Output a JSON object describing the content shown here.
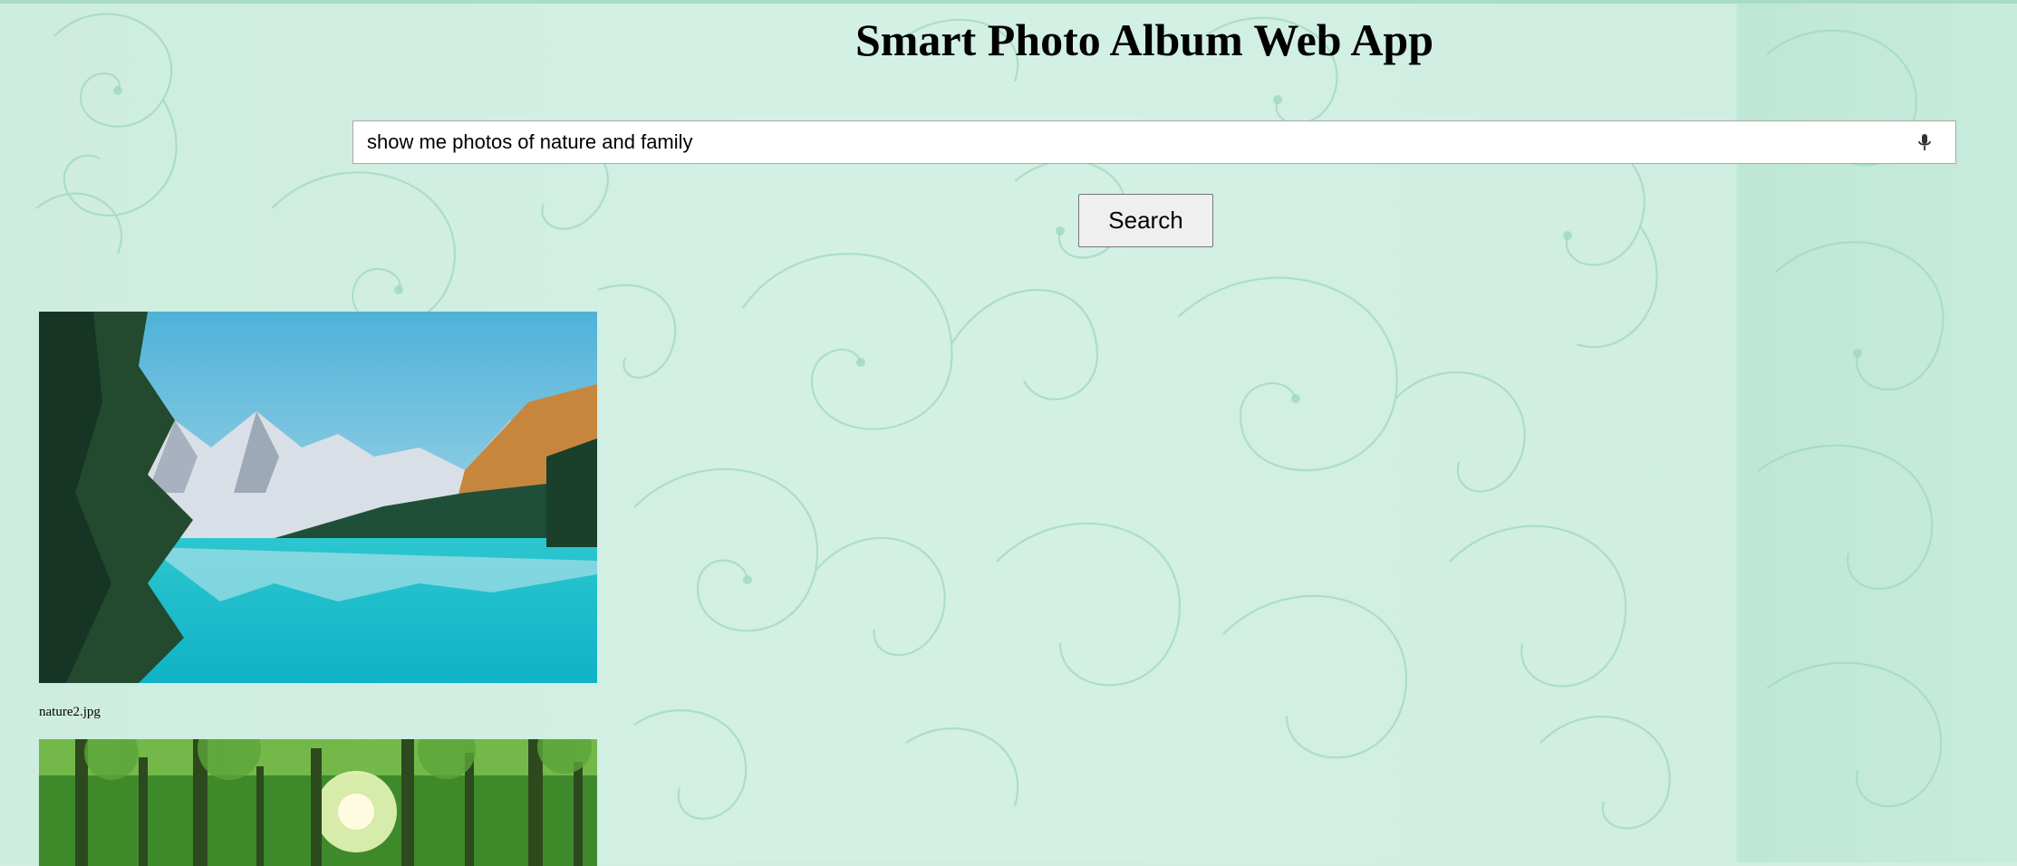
{
  "app": {
    "title": "Smart Photo Album Web App"
  },
  "search": {
    "query": "show me photos of nature and family",
    "placeholder": "",
    "mic_icon": "microphone-icon",
    "button_label": "Search"
  },
  "results": [
    {
      "filename": "nature2.jpg",
      "image_subject": "mountain lake with pine trees"
    },
    {
      "filename": "",
      "image_subject": "sunlit green forest"
    }
  ],
  "colors": {
    "background": "#cfeee1",
    "swirl": "#9fd8bf",
    "button_bg": "#efefef"
  }
}
